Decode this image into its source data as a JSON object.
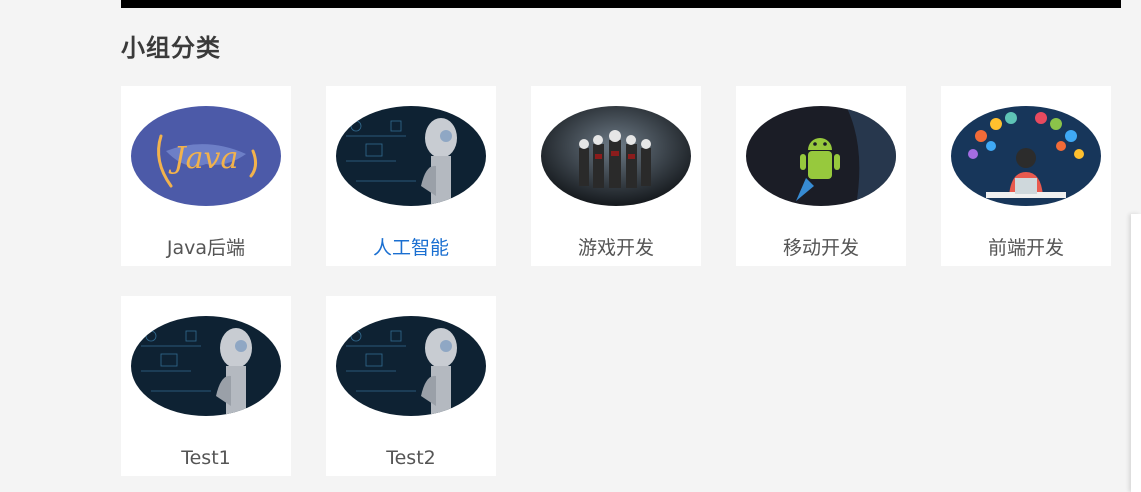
{
  "section": {
    "title": "小组分类"
  },
  "groups": [
    {
      "label": "Java后端",
      "image": "java-logo-image",
      "active": false
    },
    {
      "label": "人工智能",
      "image": "ai-robot-image",
      "active": true
    },
    {
      "label": "游戏开发",
      "image": "game-characters-image",
      "active": false
    },
    {
      "label": "移动开发",
      "image": "android-rocket-image",
      "active": false
    },
    {
      "label": "前端开发",
      "image": "frontend-developer-image",
      "active": false
    },
    {
      "label": "Test1",
      "image": "ai-robot-image",
      "active": false
    },
    {
      "label": "Test2",
      "image": "ai-robot-image",
      "active": false
    }
  ],
  "java_logo_text": "Java",
  "colors": {
    "active_label": "#1a6fd1",
    "label": "#555555",
    "java_bg": "#4c5aa8"
  }
}
